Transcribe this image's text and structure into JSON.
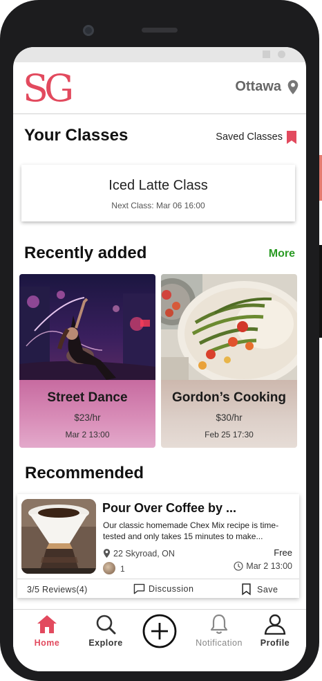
{
  "header": {
    "logo_text": "SG",
    "city": "Ottawa"
  },
  "your_classes": {
    "title": "Your Classes",
    "saved_label": "Saved Classes",
    "card": {
      "name": "Iced Latte Class",
      "next": "Next Class: Mar 06 16:00"
    }
  },
  "recently_added": {
    "title": "Recently added",
    "more_label": "More",
    "items": [
      {
        "title": "Street Dance",
        "price": "$23/hr",
        "date": "Mar 2 13:00"
      },
      {
        "title": "Gordon’s Cooking",
        "price": "$30/hr",
        "date": "Feb 25 17:30"
      }
    ]
  },
  "recommended": {
    "title": "Recommended",
    "item": {
      "title": "Pour Over Coffee by ...",
      "description": "Our classic homemade Chex Mix recipe is time-tested and only takes 15 minutes to make...",
      "location": "22 Skyroad, ON",
      "price": "Free",
      "attendees": "1",
      "date": "Mar 2 13:00",
      "reviews": "3/5 Reviews(4)",
      "discussion_label": "Discussion",
      "save_label": "Save"
    }
  },
  "nav": {
    "home": "Home",
    "explore": "Explore",
    "notification": "Notification",
    "profile": "Profile"
  },
  "colors": {
    "brand": "#e24a5e",
    "more_link": "#2a9a23"
  }
}
